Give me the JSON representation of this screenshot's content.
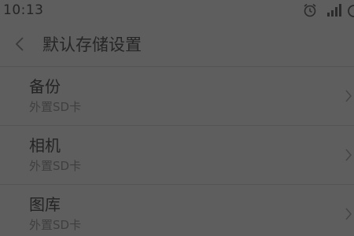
{
  "status_bar": {
    "time": "10:13",
    "icons": [
      "alarm-icon",
      "signal-icon",
      "battery-icon"
    ]
  },
  "header": {
    "back_icon": "chevron-left-icon",
    "title": "默认存储设置"
  },
  "settings": [
    {
      "title": "备份",
      "subtitle": "外置SD卡"
    },
    {
      "title": "相机",
      "subtitle": "外置SD卡"
    },
    {
      "title": "图库",
      "subtitle": "外置SD卡"
    }
  ],
  "colors": {
    "background": "#5e5e5e",
    "text_primary": "#232323",
    "text_secondary": "#3f3f3f",
    "divider": "#545454"
  }
}
